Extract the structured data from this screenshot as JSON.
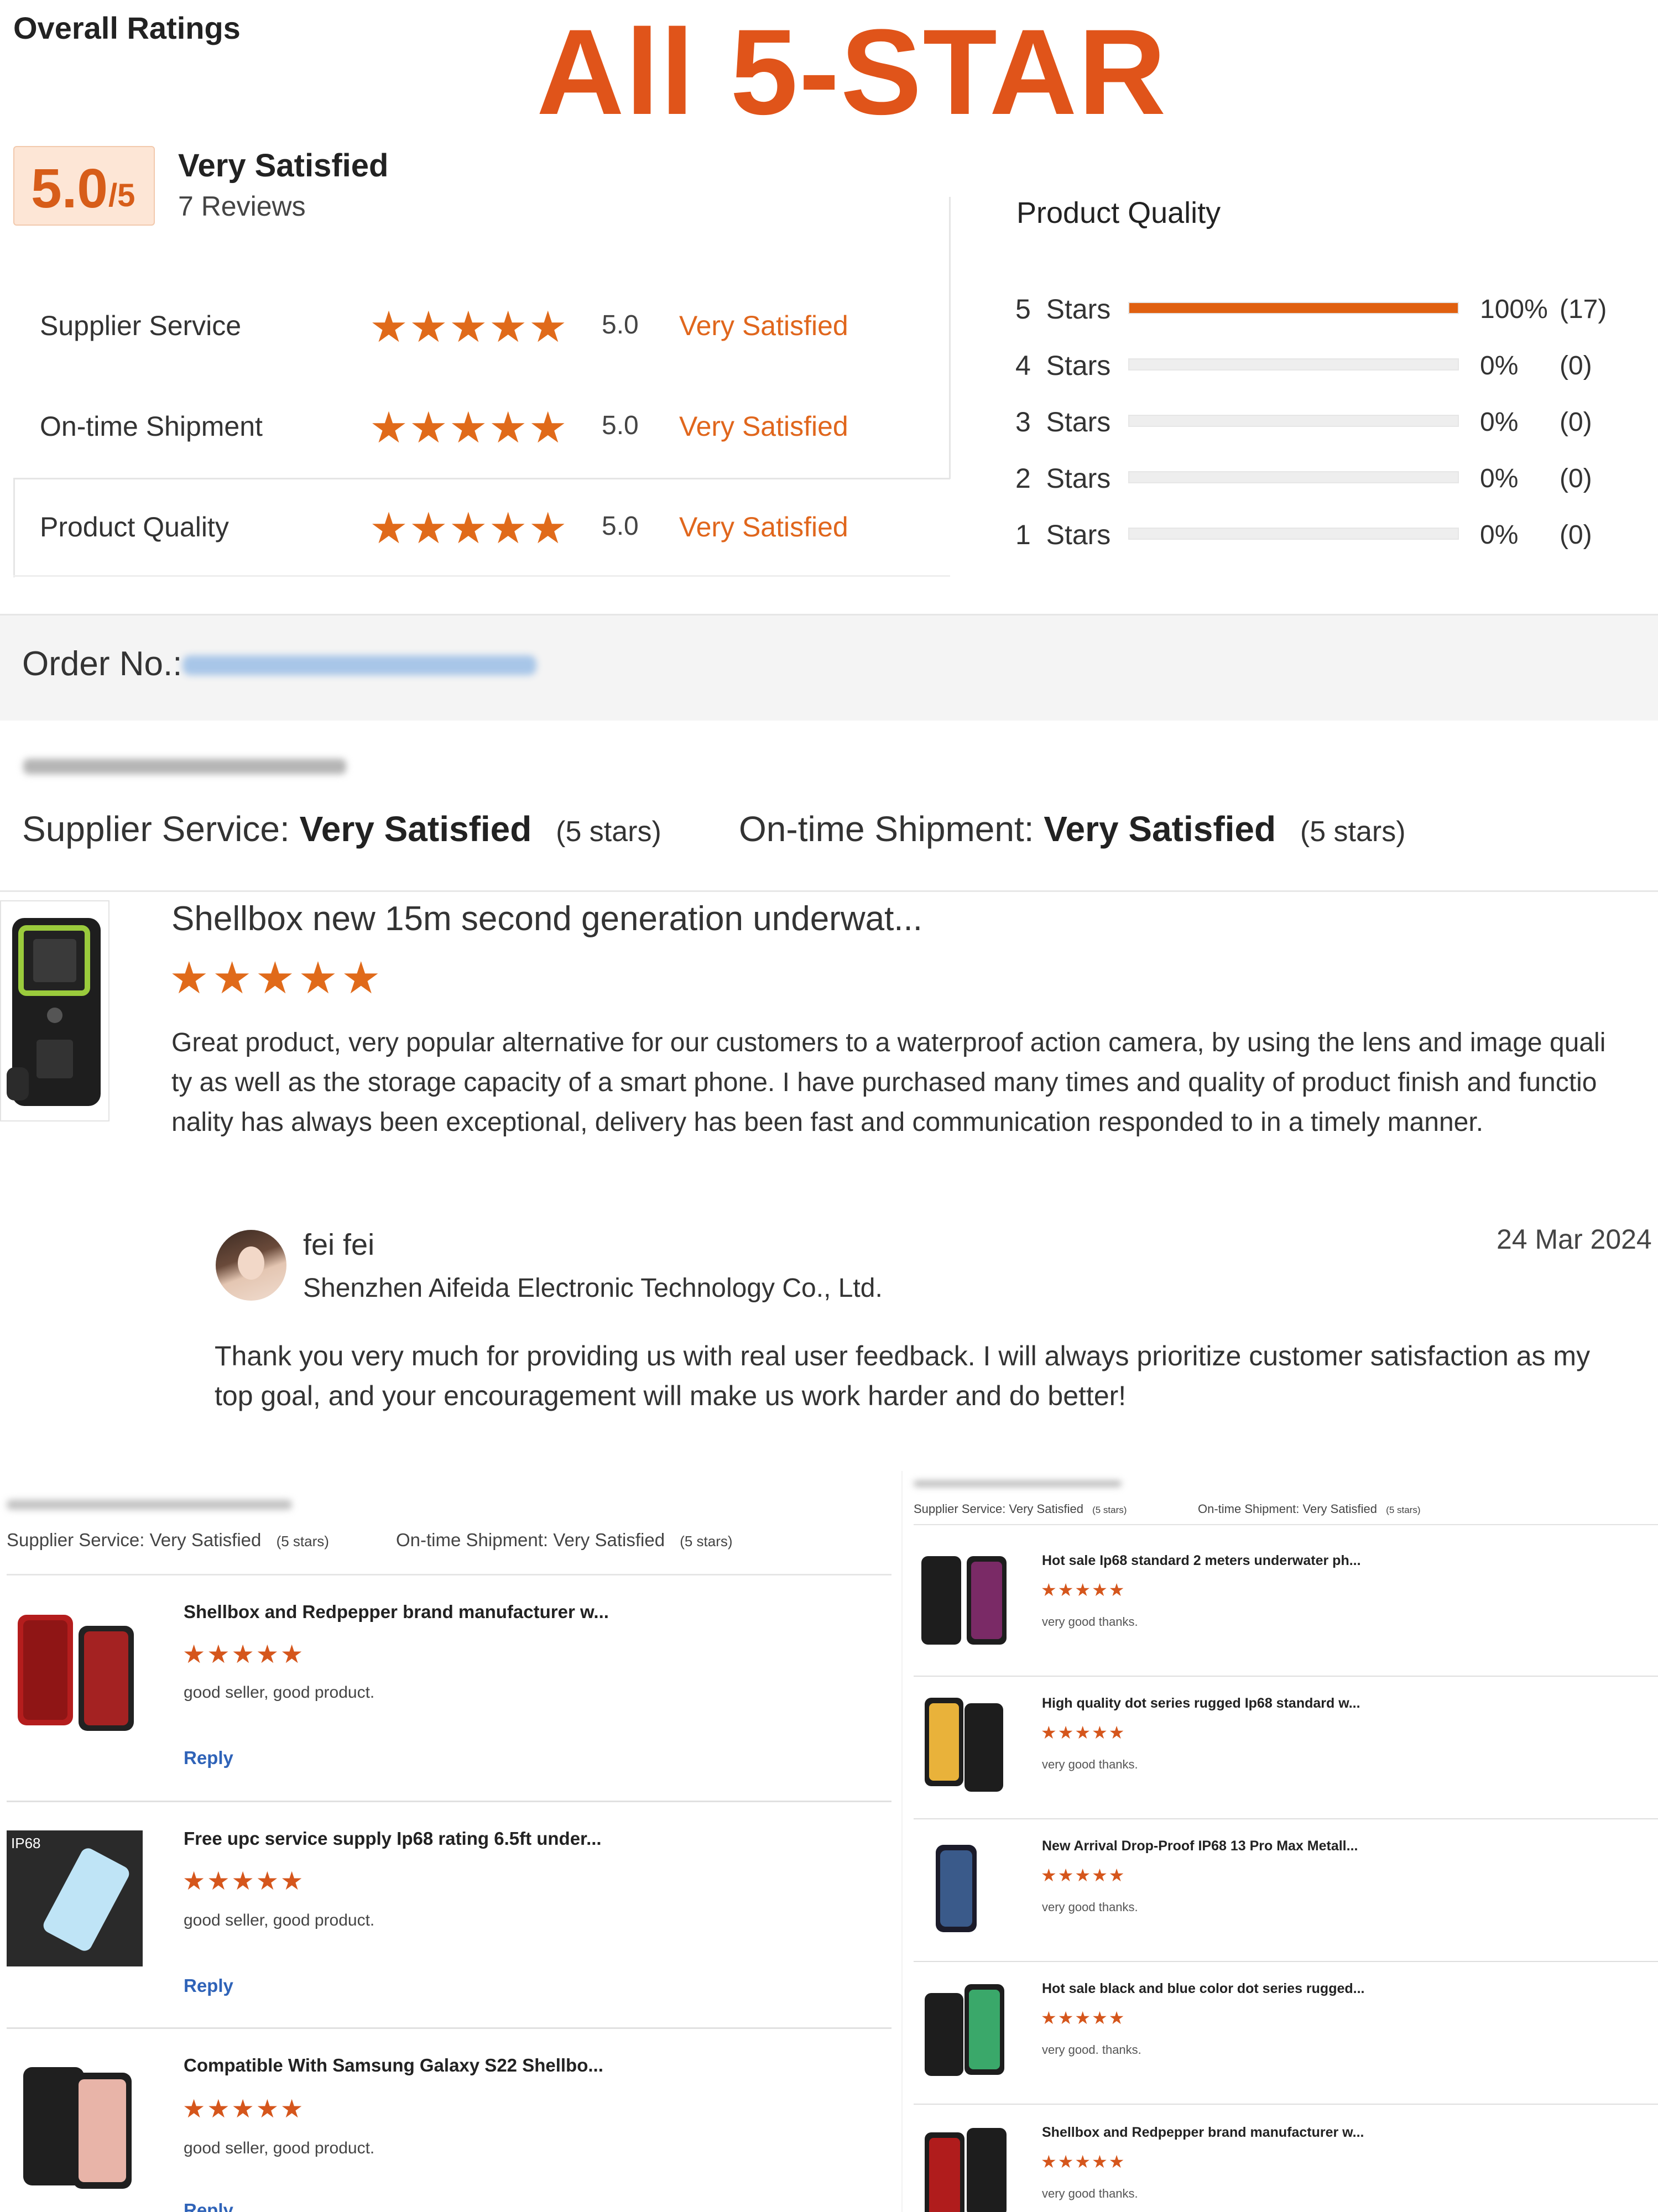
{
  "header": {
    "overall_label": "Overall Ratings",
    "banner": "All 5-STAR"
  },
  "summary": {
    "score": "5.0",
    "score_suffix": "/5",
    "verdict": "Very Satisfied",
    "reviews_count": "7 Reviews"
  },
  "ratings": [
    {
      "label": "Supplier Service",
      "value": "5.0",
      "verdict": "Very Satisfied",
      "stars": 5
    },
    {
      "label": "On-time Shipment",
      "value": "5.0",
      "verdict": "Very Satisfied",
      "stars": 5
    },
    {
      "label": "Product Quality",
      "value": "5.0",
      "verdict": "Very Satisfied",
      "stars": 5
    }
  ],
  "product_quality": {
    "title": "Product Quality",
    "rows": [
      {
        "label": "5  Stars",
        "pct": "100%",
        "count": "(17)",
        "fraction": 1.0
      },
      {
        "label": "4  Stars",
        "pct": "0%",
        "count": "(0)",
        "fraction": 0
      },
      {
        "label": "3  Stars",
        "pct": "0%",
        "count": "(0)",
        "fraction": 0
      },
      {
        "label": "2  Stars",
        "pct": "0%",
        "count": "(0)",
        "fraction": 0
      },
      {
        "label": "1  Stars",
        "pct": "0%",
        "count": "(0)",
        "fraction": 0
      }
    ]
  },
  "order": {
    "label": "Order No.:"
  },
  "review": {
    "supplier_label": "Supplier Service:",
    "supplier_value": "Very Satisfied",
    "supplier_stars": "(5 stars)",
    "shipment_label": "On-time Shipment:",
    "shipment_value": "Very Satisfied",
    "shipment_stars": "(5 stars)",
    "product_title": "Shellbox new 15m second generation underwat...",
    "stars": "★★★★★",
    "text": "Great product, very popular alternative for our customers to a waterproof action camera,  by using  the lens and image quality as well as the storage capacity of a smart phone. I have purchased many times and quality of product finish and functionality has always been exceptional, delivery has been fast and communication responded to in a timely manner.",
    "reply_name": "fei fei",
    "reply_company": "Shenzhen Aifeida Electronic Technology Co., Ltd.",
    "reply_date": "24 Mar 2024",
    "reply_text": "Thank you very much for providing us with real user feedback. I will always prioritize customer satisfaction as my top goal, and your encouragement will make us work harder and do better!"
  },
  "left_reviews": {
    "supplier": "Supplier Service: Very Satisfied",
    "supplier_stars": "(5 stars)",
    "shipment": "On-time Shipment: Very Satisfied",
    "shipment_stars": "(5 stars)",
    "items": [
      {
        "title": "Shellbox and Redpepper brand manufacturer w...",
        "stars": "★★★★★",
        "text": "good seller, good product.",
        "reply": "Reply"
      },
      {
        "title": "Free upc service supply Ip68 rating 6.5ft under...",
        "stars": "★★★★★",
        "text": "good seller, good product.",
        "reply": "Reply"
      },
      {
        "title": "Compatible With Samsung Galaxy S22 Shellbo...",
        "stars": "★★★★★",
        "text": "good seller, good product.",
        "reply": "Reply"
      }
    ],
    "thumb_badge": "IP68"
  },
  "right_reviews": {
    "supplier": "Supplier Service: Very Satisfied",
    "supplier_stars": "(5 stars)",
    "shipment": "On-time Shipment: Very Satisfied",
    "shipment_stars": "(5 stars)",
    "items": [
      {
        "title": "Hot sale Ip68 standard 2 meters underwater ph...",
        "stars": "★★★★★",
        "text": "very good  thanks."
      },
      {
        "title": "High quality dot series rugged Ip68 standard w...",
        "stars": "★★★★★",
        "text": "very good  thanks."
      },
      {
        "title": "New Arrival Drop-Proof IP68 13 Pro Max Metall...",
        "stars": "★★★★★",
        "text": "very good  thanks."
      },
      {
        "title": "Hot sale black and blue color dot series rugged...",
        "stars": "★★★★★",
        "text": "very good. thanks."
      },
      {
        "title": "Shellbox and Redpepper brand manufacturer w...",
        "stars": "★★★★★",
        "text": "very good  thanks."
      }
    ]
  },
  "colors": {
    "accent": "#e0661c",
    "star": "#e06a1a",
    "link": "#2f63b8"
  }
}
